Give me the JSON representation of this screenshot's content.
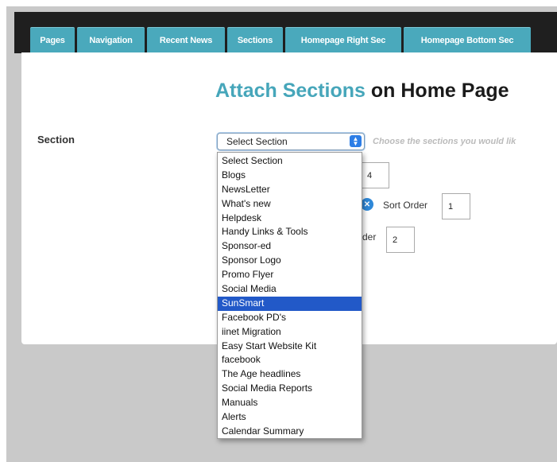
{
  "tabs": [
    "Pages",
    "Navigation",
    "Recent News",
    "Sections",
    "Homepage Right Sec",
    "Homepage Bottom Sec"
  ],
  "heading": {
    "accent": "Attach Sections",
    "rest": " on Home Page"
  },
  "form": {
    "section_label": "Section",
    "select_value": "Select Section",
    "hint": "Choose the sections you would lik",
    "value_top": "4",
    "sort_order_label": "Sort Order",
    "sort_order_value": "1",
    "order_label_partial": "der",
    "order_value": "2"
  },
  "dropdown": {
    "selected": "SunSmart",
    "options": [
      "Select Section",
      "Blogs",
      "NewsLetter",
      "What's new",
      "Helpdesk",
      "Handy Links & Tools",
      "Sponsor-ed",
      "Sponsor Logo",
      "Promo Flyer",
      "Social Media",
      "SunSmart",
      "Facebook PD's",
      "iinet Migration",
      "Easy Start Website Kit",
      "facebook",
      "The Age headlines",
      "Social Media Reports",
      "Manuals",
      "Alerts",
      "Calendar Summary"
    ]
  },
  "icons": {
    "select_arrow": "updown-chevron-icon",
    "remove": "close-circle-icon"
  },
  "colors": {
    "accent": "#46a6ba",
    "tab": "#4aa9bc",
    "selected_option": "#2259c8"
  }
}
